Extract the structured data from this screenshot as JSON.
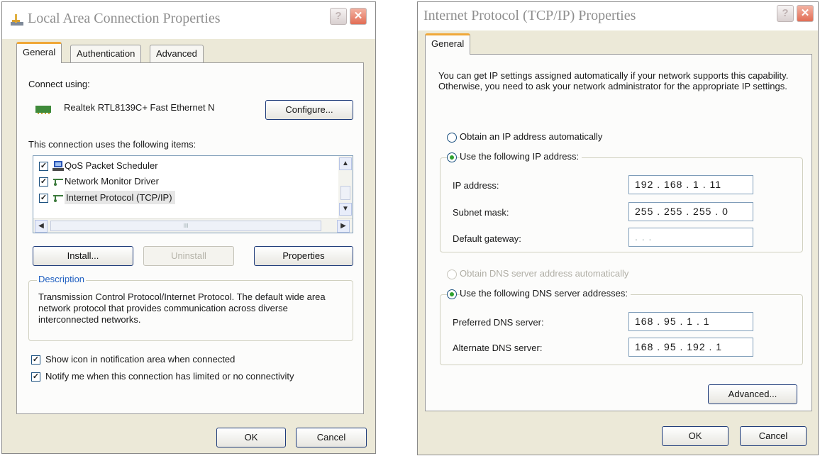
{
  "left_window": {
    "title": "Local Area Connection Properties",
    "tabs": [
      "General",
      "Authentication",
      "Advanced"
    ],
    "connect_using_label": "Connect using:",
    "adapter_name": "Realtek RTL8139C+ Fast Ethernet N",
    "configure_button": "Configure...",
    "items_label": "This connection uses the following items:",
    "items": [
      {
        "label": "QoS Packet Scheduler",
        "checked": true,
        "icon": "scheduler-icon"
      },
      {
        "label": "Network Monitor Driver",
        "checked": true,
        "icon": "network-protocol-icon"
      },
      {
        "label": "Internet Protocol (TCP/IP)",
        "checked": true,
        "selected": true,
        "icon": "network-protocol-icon"
      }
    ],
    "scroll_thumb_glyph": "III",
    "install_button": "Install...",
    "uninstall_button": "Uninstall",
    "properties_button": "Properties",
    "description_legend": "Description",
    "description_text": "Transmission Control Protocol/Internet Protocol. The default wide area network protocol that provides communication across diverse interconnected networks.",
    "show_icon_label": "Show icon in notification area when connected",
    "notify_label": "Notify me when this connection has limited or no connectivity",
    "ok_button": "OK",
    "cancel_button": "Cancel"
  },
  "right_window": {
    "title": "Internet Protocol (TCP/IP) Properties",
    "tab": "General",
    "intro_text": "You can get IP settings assigned automatically if your network supports this capability. Otherwise, you need to ask your network administrator for the appropriate IP settings.",
    "obtain_ip_auto": "Obtain an IP address automatically",
    "use_following_ip": "Use the following IP address:",
    "ip_address_label": "IP address:",
    "ip_address_value": "192 . 168 . 1 . 11",
    "subnet_mask_label": "Subnet mask:",
    "subnet_mask_value": "255 . 255 . 255 . 0",
    "gateway_label": "Default gateway:",
    "gateway_value": ".       .       .",
    "obtain_dns_auto": "Obtain DNS server address automatically",
    "use_following_dns": "Use the following DNS server addresses:",
    "preferred_dns_label": "Preferred DNS server:",
    "preferred_dns_value": "168 . 95 . 1 . 1",
    "alternate_dns_label": "Alternate DNS server:",
    "alternate_dns_value": "168 . 95 . 192 . 1",
    "advanced_button": "Advanced...",
    "ok_button": "OK",
    "cancel_button": "Cancel"
  },
  "glyphs": {
    "help": "?",
    "close": "✕",
    "check": "✓",
    "scroll_up": "▲",
    "scroll_down": "▼",
    "scroll_left": "◀",
    "scroll_right": "▶"
  },
  "colors": {
    "dialog_bg": "#ece9d8",
    "panel_bg": "#fcfcfb",
    "active_tab_accent": "#f0a838",
    "radio_dot": "#2fa12f",
    "close_red": "#e26d55"
  }
}
